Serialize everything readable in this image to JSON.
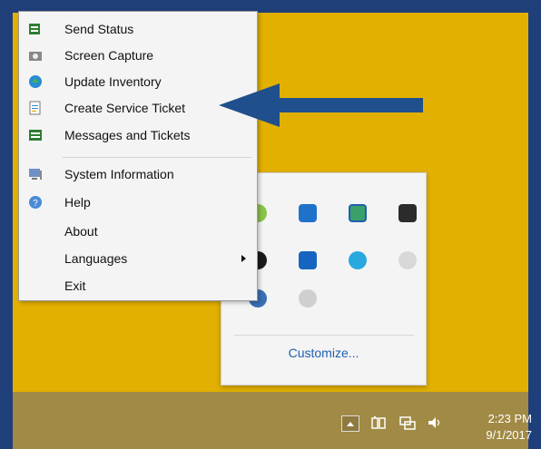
{
  "menu": {
    "items": [
      {
        "label": "Send Status",
        "icon": "send-status-icon"
      },
      {
        "label": "Screen Capture",
        "icon": "camera-icon"
      },
      {
        "label": "Update Inventory",
        "icon": "globe-update-icon"
      },
      {
        "label": "Create Service Ticket",
        "icon": "document-ticket-icon"
      },
      {
        "label": "Messages and Tickets",
        "icon": "messages-icon"
      },
      {
        "label": "System Information",
        "icon": "computer-icon"
      },
      {
        "label": "Help",
        "icon": "help-icon"
      },
      {
        "label": "About",
        "icon": ""
      },
      {
        "label": "Languages",
        "icon": ""
      },
      {
        "label": "Exit",
        "icon": ""
      }
    ]
  },
  "tray_popup": {
    "customize_label": "Customize..."
  },
  "taskbar": {
    "time": "2:23 PM",
    "date": "9/1/2017"
  },
  "colors": {
    "desktop": "#e2b000",
    "frame": "#1f3f7a",
    "arrow": "#1f4f8c",
    "taskbar": "#a08a45",
    "link": "#1e5fb0"
  }
}
